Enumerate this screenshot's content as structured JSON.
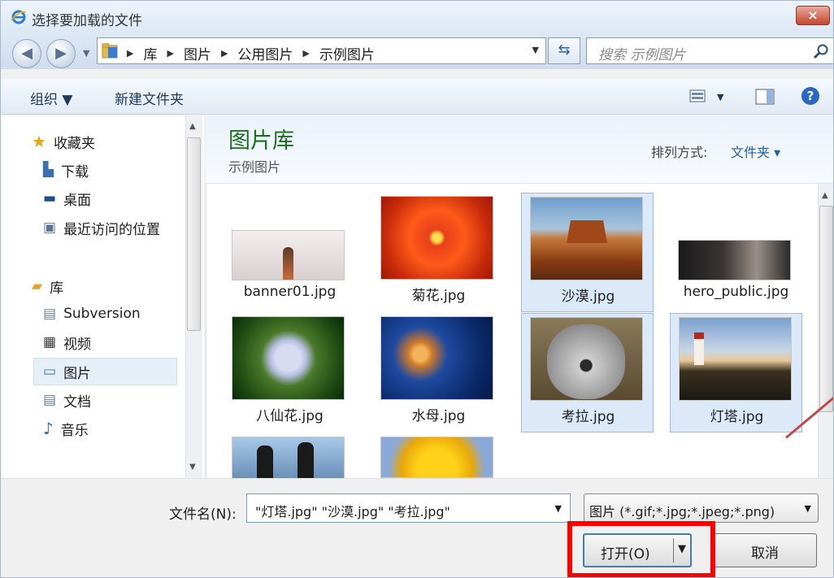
{
  "window": {
    "title": "选择要加载的文件",
    "close_label": "×"
  },
  "address": {
    "crumbs": [
      "库",
      "图片",
      "公用图片",
      "示例图片"
    ],
    "search_placeholder": "搜索 示例图片"
  },
  "toolbar": {
    "organize": "组织 ▼",
    "new_folder": "新建文件夹"
  },
  "nav": {
    "favorites": "收藏夹",
    "downloads": "下载",
    "desktop": "桌面",
    "recent": "最近访问的位置",
    "libraries": "库",
    "subversion": "Subversion",
    "videos": "视频",
    "pictures": "图片",
    "documents": "文档",
    "music": "音乐"
  },
  "library": {
    "title": "图片库",
    "subtitle": "示例图片",
    "sort_label": "排列方式:",
    "sort_value": "文件夹 ▾"
  },
  "files": [
    {
      "name": "banner01.jpg",
      "selected": false
    },
    {
      "name": "菊花.jpg",
      "selected": false
    },
    {
      "name": "沙漠.jpg",
      "selected": true
    },
    {
      "name": "hero_public.jpg",
      "selected": false
    },
    {
      "name": "八仙花.jpg",
      "selected": false
    },
    {
      "name": "水母.jpg",
      "selected": false
    },
    {
      "name": "考拉.jpg",
      "selected": true
    },
    {
      "name": "灯塔.jpg",
      "selected": true
    }
  ],
  "bottom": {
    "filename_label": "文件名(N):",
    "filename_value": "\"灯塔.jpg\" \"沙漠.jpg\" \"考拉.jpg\"",
    "filetype_value": "图片 (*.gif;*.jpg;*.jpeg;*.png)",
    "open_label": "打开(O)",
    "cancel_label": "取消"
  }
}
